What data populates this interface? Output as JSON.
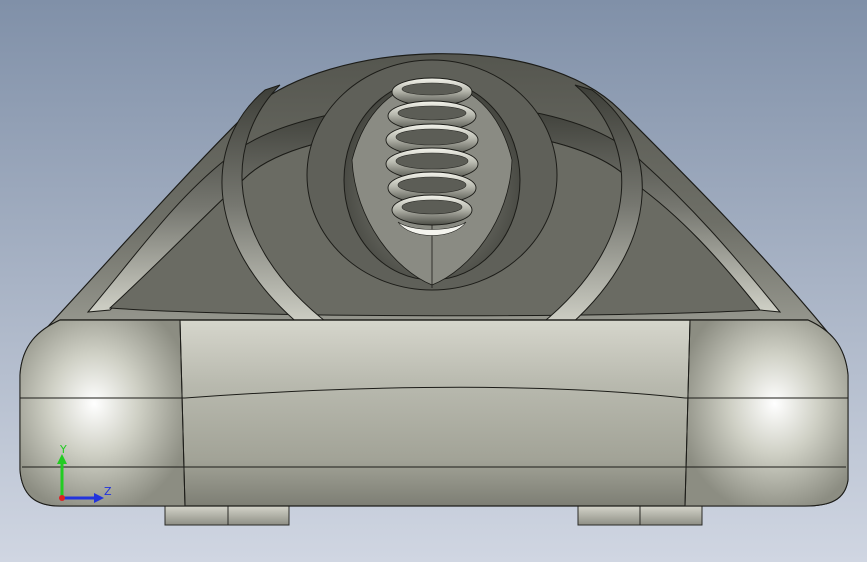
{
  "viewport": {
    "background_top": "#8090a8",
    "background_bottom": "#d0d6e2"
  },
  "model": {
    "body_dark": "#4e4f48",
    "body_mid": "#8a8b82",
    "body_light": "#e8e8e0",
    "edge": "#1c1c18"
  },
  "triad": {
    "y_label": "Y",
    "z_label": "Z",
    "y_color": "#22cc22",
    "z_color": "#2233dd",
    "x_color": "#dd2222"
  }
}
